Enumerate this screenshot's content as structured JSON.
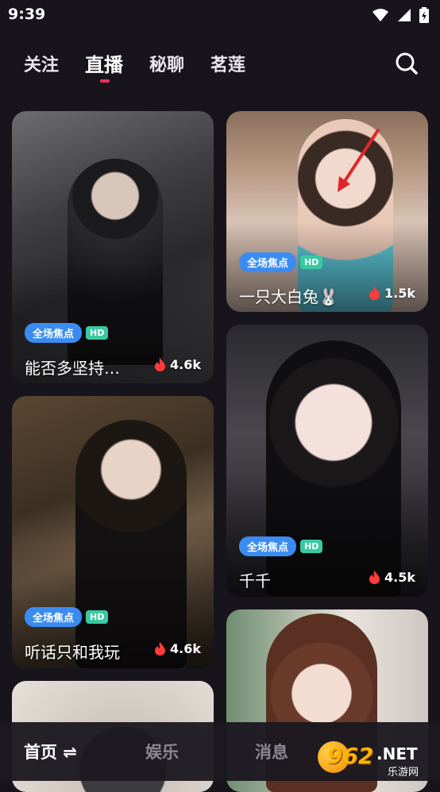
{
  "status": {
    "time": "9:39"
  },
  "top_tabs": [
    {
      "label": "关注"
    },
    {
      "label": "直播"
    },
    {
      "label": "秘聊"
    },
    {
      "label": "茗莲"
    }
  ],
  "cards": [
    {
      "badge": "全场焦点",
      "hd": "HD",
      "title": "能否多坚持…",
      "count": "4.6k"
    },
    {
      "badge": "全场焦点",
      "hd": "HD",
      "title": "一只大白兔🐰",
      "count": "1.5k"
    },
    {
      "badge": "全场焦点",
      "hd": "HD",
      "title": "听话只和我玩",
      "count": "4.6k"
    },
    {
      "badge": "全场焦点",
      "hd": "HD",
      "title": "千千",
      "count": "4.5k"
    }
  ],
  "bottom_nav": [
    {
      "label": "首页 ⇌"
    },
    {
      "label": "娱乐"
    },
    {
      "label": "消息"
    }
  ],
  "watermark": {
    "number": "962",
    "suffix": ".NET",
    "caption": "乐游网"
  },
  "icons": [
    "wifi-icon",
    "signal-icon",
    "battery-icon",
    "search-icon",
    "fire-icon"
  ],
  "colors": {
    "accent": "#ff2e5a",
    "badge_blue": "#3b8cf2",
    "badge_green": "#39c9a1",
    "background": "#17141c"
  }
}
